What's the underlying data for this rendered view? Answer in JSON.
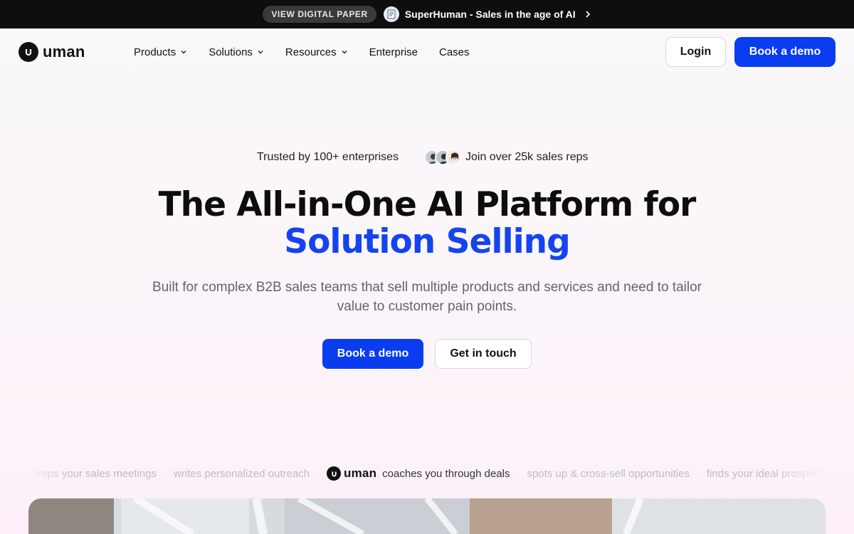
{
  "announcement": {
    "pill_label": "VIEW DIGITAL PAPER",
    "text": "SuperHuman - Sales in the age of AI"
  },
  "brand": {
    "name": "uman"
  },
  "nav": {
    "items": [
      {
        "label": "Products"
      },
      {
        "label": "Solutions"
      },
      {
        "label": "Resources"
      },
      {
        "label": "Enterprise"
      },
      {
        "label": "Cases"
      }
    ],
    "login_label": "Login",
    "demo_label": "Book a demo"
  },
  "hero": {
    "trusted": "Trusted by 100+ enterprises",
    "join": "Join over 25k sales reps",
    "headline_line1": "The All-in-One AI Platform for",
    "headline_line2": "Solution Selling",
    "subtitle": "Built for complex B2B sales teams that sell multiple products and services and need to tailor value to customer pain points.",
    "primary_cta": "Book a demo",
    "secondary_cta": "Get in touch"
  },
  "ticker": {
    "before": [
      "preps your sales meetings",
      "writes personalized outreach"
    ],
    "active": "coaches you through deals",
    "after": [
      "spots up & cross-sell opportunities",
      "finds your ideal prospects"
    ]
  },
  "colors": {
    "accent": "#0a3cf0",
    "headline_accent": "#1444ee",
    "topbar": "#0e0e0e"
  }
}
